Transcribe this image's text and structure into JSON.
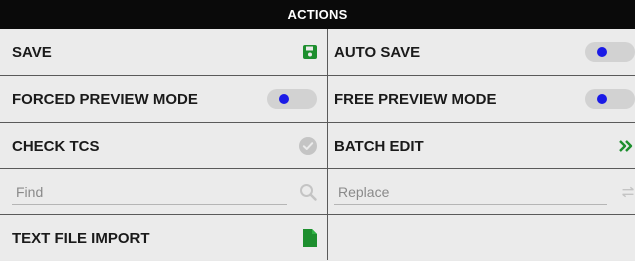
{
  "header": {
    "title": "ACTIONS"
  },
  "colors": {
    "header_bg": "#0a0a0a",
    "panel_bg": "#ebebeb",
    "accent_green": "#1d8f2e",
    "toggle_knob": "#1a1ae6"
  },
  "actions": {
    "save": {
      "label": "SAVE",
      "icon": "floppy-disk-icon"
    },
    "auto_save": {
      "label": "AUTO SAVE",
      "enabled": false
    },
    "forced_preview": {
      "label": "FORCED PREVIEW MODE",
      "enabled": false
    },
    "free_preview": {
      "label": "FREE PREVIEW MODE",
      "enabled": false
    },
    "check_tcs": {
      "label": "CHECK TCS",
      "icon": "check-circle-icon"
    },
    "batch_edit": {
      "label": "BATCH EDIT",
      "icon": "double-chevron-right-icon"
    },
    "find": {
      "placeholder": "Find",
      "value": "",
      "icon": "search-icon"
    },
    "replace": {
      "placeholder": "Replace",
      "value": "",
      "icon": "replace-arrows-icon"
    },
    "text_file_import": {
      "label": "TEXT FILE IMPORT",
      "icon": "file-icon"
    }
  }
}
